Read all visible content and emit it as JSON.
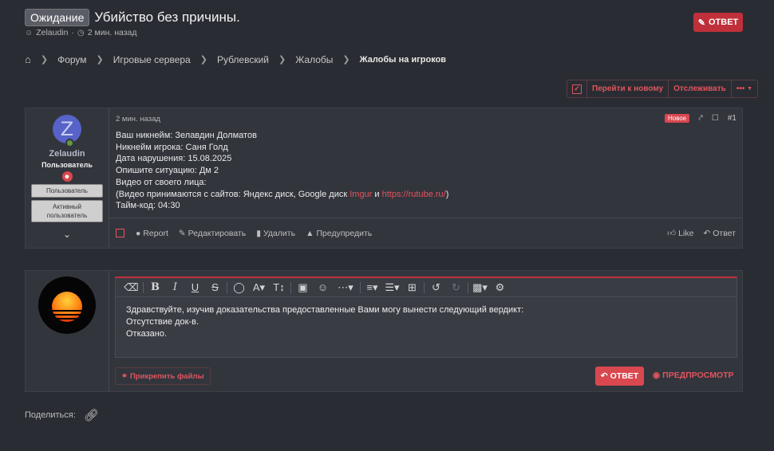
{
  "thread": {
    "prefix": "Ожидание",
    "title": "Убийство без причины.",
    "author": "Zelaudin",
    "time": "2 мин. назад",
    "reply_label": "ОТВЕТ"
  },
  "breadcrumb": [
    "Форум",
    "Игровые сервера",
    "Рублевский",
    "Жалобы",
    "Жалобы на игроков"
  ],
  "actions": {
    "goto_new": "Перейти к новому",
    "watch": "Отслеживать",
    "more": "•••"
  },
  "post": {
    "username": "Zelaudin",
    "avatar_letter": "Z",
    "user_title": "Пользователь",
    "banners": [
      "Пользователь",
      "Активный пользователь"
    ],
    "date": "2 мин. назад",
    "badge": "Новое",
    "number": "#1",
    "lines": [
      "Ваш никнейм: Зелавдин Долматов",
      "Никнейм игрока: Саня Голд",
      "Дата нарушения: 15.08.2025",
      "Опишите ситуацию: Дм 2",
      "Видео от своего лица:"
    ],
    "video_prefix": "(Видео принимаются с сайтов: Яндекс диск, Google диск ",
    "link_imgur": "Imgur",
    "video_and": " и ",
    "link_rutube": "https://rutube.ru/",
    "video_suffix": ")",
    "timecode": "Тайм-код: 04:30",
    "footer": {
      "report": "Report",
      "edit": "Редактировать",
      "delete": "Удалить",
      "warn": "Предупредить",
      "like": "Like",
      "reply": "Ответ"
    }
  },
  "reply": {
    "text_lines": [
      "Здравствуйте, изучив доказательства предоставленные Вами могу вынести следующий вердикт:",
      "Отсутствие док-в.",
      "Отказано."
    ],
    "attach_label": "Прикрепить файлы",
    "submit_label": "ОТВЕТ",
    "preview_label": "ПРЕДПРОСМОТР"
  },
  "share": {
    "label": "Поделиться:"
  },
  "colors": {
    "accent": "#d9474f",
    "background": "#2a2c33",
    "panel": "#33353d"
  }
}
